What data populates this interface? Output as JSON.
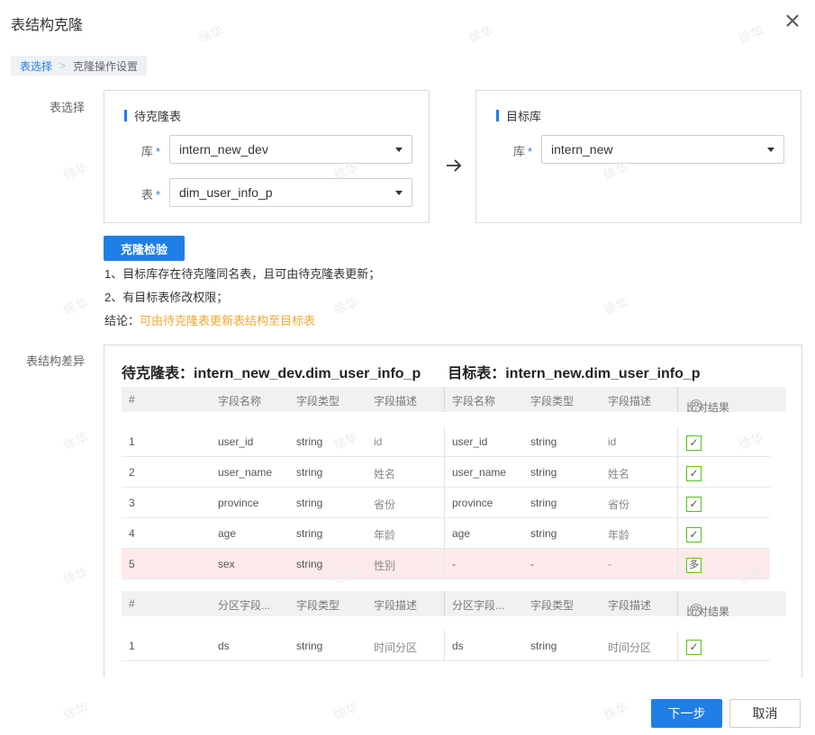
{
  "dialog": {
    "title": "表结构克隆"
  },
  "steps": {
    "step1": "表选择",
    "separator": ">",
    "step2": "克隆操作设置"
  },
  "table_select": {
    "label": "表选择",
    "source": {
      "heading": "待克隆表",
      "db_label": "库",
      "db_value": "intern_new_dev",
      "table_label": "表",
      "table_value": "dim_user_info_p",
      "required_mark": "*"
    },
    "target": {
      "heading": "目标库",
      "db_label": "库",
      "db_value": "intern_new",
      "required_mark": "*"
    }
  },
  "check": {
    "button_label": "克隆检验",
    "rule1": "1、目标库存在待克隆同名表，且可由待克隆表更新；",
    "rule2": "2、有目标表修改权限；",
    "conclusion_prefix": "结论：",
    "conclusion": "可由待克隆表更新表结构至目标表"
  },
  "diff": {
    "label": "表结构差异",
    "source_title": "待克隆表：intern_new_dev.dim_user_info_p",
    "target_title": "目标表：intern_new.dim_user_info_p",
    "field_header": {
      "index": "#",
      "src_name": "字段名称",
      "src_type": "字段类型",
      "src_desc": "字段描述",
      "dst_name": "字段名称",
      "dst_type": "字段类型",
      "dst_desc": "字段描述",
      "result": "比对结果",
      "help": "?"
    },
    "field_rows": [
      {
        "index": "1",
        "src_name": "user_id",
        "src_type": "string",
        "src_desc": "id",
        "dst_name": "user_id",
        "dst_type": "string",
        "dst_desc": "id",
        "result": "✓"
      },
      {
        "index": "2",
        "src_name": "user_name",
        "src_type": "string",
        "src_desc": "姓名",
        "dst_name": "user_name",
        "dst_type": "string",
        "dst_desc": "姓名",
        "result": "✓"
      },
      {
        "index": "3",
        "src_name": "province",
        "src_type": "string",
        "src_desc": "省份",
        "dst_name": "province",
        "dst_type": "string",
        "dst_desc": "省份",
        "result": "✓"
      },
      {
        "index": "4",
        "src_name": "age",
        "src_type": "string",
        "src_desc": "年龄",
        "dst_name": "age",
        "dst_type": "string",
        "dst_desc": "年龄",
        "result": "✓"
      },
      {
        "index": "5",
        "src_name": "sex",
        "src_type": "string",
        "src_desc": "性别",
        "dst_name": "-",
        "dst_type": "-",
        "dst_desc": "-",
        "result": "多"
      }
    ],
    "partition_header": {
      "index": "#",
      "src_name": "分区字段...",
      "src_type": "字段类型",
      "src_desc": "字段描述",
      "dst_name": "分区字段...",
      "dst_type": "字段类型",
      "dst_desc": "字段描述",
      "result": "比对结果",
      "help": "?"
    },
    "partition_rows": [
      {
        "index": "1",
        "src_name": "ds",
        "src_type": "string",
        "src_desc": "时间分区",
        "dst_name": "ds",
        "dst_type": "string",
        "dst_desc": "时间分区",
        "result": "✓"
      }
    ]
  },
  "footer": {
    "next_label": "下一步",
    "cancel_label": "取消"
  },
  "watermark": "徐华",
  "colors": {
    "primary": "#1f7fe6",
    "warning_text": "#f0a830",
    "match": "#52c41a",
    "mismatch_row": "#fdeaea"
  }
}
